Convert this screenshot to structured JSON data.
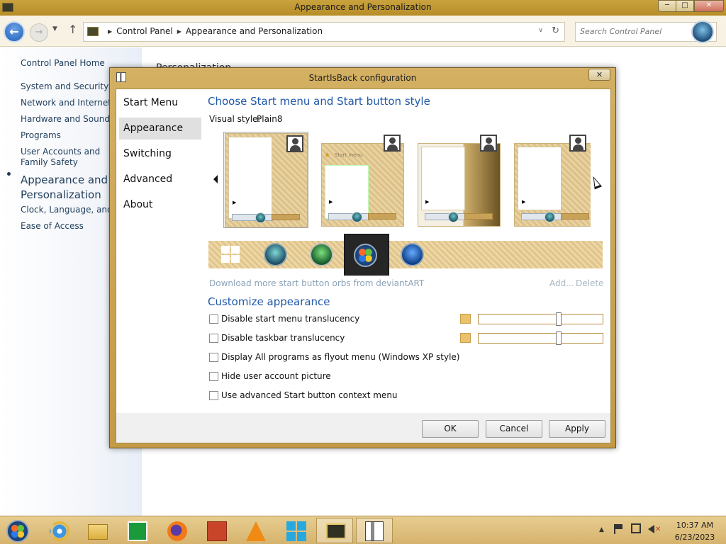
{
  "window": {
    "title": "Appearance and Personalization",
    "minimize": "─",
    "maximize": "□",
    "close": "✕"
  },
  "nav": {
    "back": "←",
    "forward": "→",
    "up": "↑",
    "history": "▼",
    "breadcrumb": [
      "Control Panel",
      "Appearance and Personalization"
    ],
    "search_placeholder": "Search Control Panel",
    "dropdown": "∨",
    "refresh": "↻"
  },
  "sidebar": {
    "home": "Control Panel Home",
    "items": [
      "System and Security",
      "Network and Internet",
      "Hardware and Sound",
      "Programs",
      "User Accounts and Family Safety",
      "Appearance and Personalization",
      "Clock, Language, and Region",
      "Ease of Access"
    ],
    "current_index": 5
  },
  "main": {
    "heading_peek": "Personalization"
  },
  "dialog": {
    "title": "StartIsBack configuration",
    "close": "✕",
    "nav": [
      "Start Menu",
      "Appearance",
      "Switching",
      "Advanced",
      "About"
    ],
    "selected_nav": "Appearance",
    "style_heading": "Choose Start menu and Start button style",
    "visual_style_label": "Visual style:",
    "visual_style_value": "Plain8",
    "style_thumbnails": [
      "Plain8",
      "Style 2",
      "Style 3",
      "Style 4"
    ],
    "thumb2_label": "Start menu",
    "selected_style_index": 0,
    "orbs": [
      "Windows 8 logo",
      "Squares orb",
      "Clover orb",
      "White orb",
      "Windows 7 blue orb",
      "Windows 7 orb"
    ],
    "selected_orb_index": 5,
    "download_link": "Download more start button orbs from deviantART",
    "add_link": "Add...",
    "delete_link": "Delete",
    "customize_heading": "Customize appearance",
    "options": [
      {
        "label": "Disable start menu translucency",
        "checked": false
      },
      {
        "label": "Disable taskbar translucency",
        "checked": false
      },
      {
        "label": "Display All programs as flyout menu (Windows XP style)",
        "checked": false
      },
      {
        "label": "Hide user account picture",
        "checked": false
      },
      {
        "label": "Use advanced Start button context menu",
        "checked": false
      }
    ],
    "menu_translucency_level": 0.65,
    "taskbar_translucency_level": 0.65,
    "accent_color": "#ebc16c",
    "buttons": {
      "ok": "OK",
      "cancel": "Cancel",
      "apply": "Apply"
    }
  },
  "taskbar": {
    "items": [
      "Start",
      "Internet Explorer",
      "File Explorer",
      "Store",
      "Firefox",
      "PowerPoint",
      "VLC",
      "Windows",
      "Control Panel",
      "StartIsBack configuration"
    ],
    "tray_chevron": "▲",
    "mute": "✕",
    "time": "10:37 AM",
    "date": "6/23/2023"
  },
  "colors": {
    "accent_gold": "#d3b062",
    "link_blue": "#1f58a8"
  }
}
